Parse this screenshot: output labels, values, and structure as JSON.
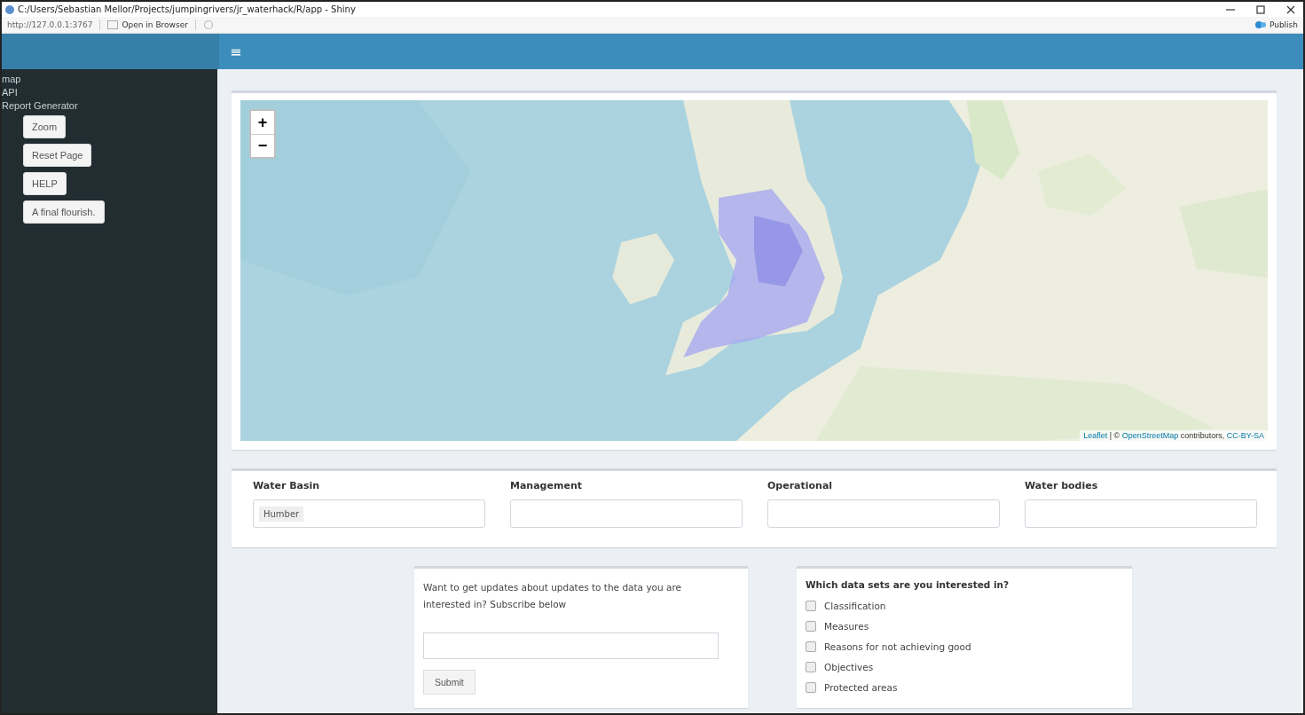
{
  "window": {
    "title": "C:/Users/Sebastian Mellor/Projects/jumpingrivers/jr_waterhack/R/app - Shiny"
  },
  "toolbar": {
    "url": "http://127.0.0.1:3767",
    "open_in_browser": "Open in Browser",
    "publish": "Publish"
  },
  "header": {
    "menu_icon": "≡"
  },
  "sidebar": {
    "items": [
      {
        "label": "map"
      },
      {
        "label": "API"
      },
      {
        "label": "Report Generator"
      }
    ],
    "buttons": [
      "Zoom",
      "Reset Page",
      "HELP",
      "A final flourish."
    ]
  },
  "map": {
    "zoom_in": "+",
    "zoom_out": "−",
    "attribution": [
      {
        "text": "Leaflet",
        "kind": "link"
      },
      {
        "text": " | © ",
        "kind": "text"
      },
      {
        "text": "OpenStreetMap",
        "kind": "link"
      },
      {
        "text": " contributors, ",
        "kind": "text"
      },
      {
        "text": "CC-BY-SA",
        "kind": "link"
      }
    ]
  },
  "filters": [
    {
      "label": "Water Basin",
      "tags": [
        "Humber"
      ]
    },
    {
      "label": "Management"
    },
    {
      "label": "Operational"
    },
    {
      "label": "Water bodies"
    }
  ],
  "subscribe": {
    "text": "Want to get updates about updates to the data you are interested in? Subscribe below",
    "button": "Submit"
  },
  "datasets": {
    "title": "Which data sets are you interested in?",
    "options": [
      {
        "label": "Classification",
        "checked": false
      },
      {
        "label": "Measures",
        "checked": false
      },
      {
        "label": "Reasons for not achieving good",
        "checked": false
      },
      {
        "label": "Objectives",
        "checked": false
      },
      {
        "label": "Protected areas",
        "checked": false
      }
    ]
  }
}
